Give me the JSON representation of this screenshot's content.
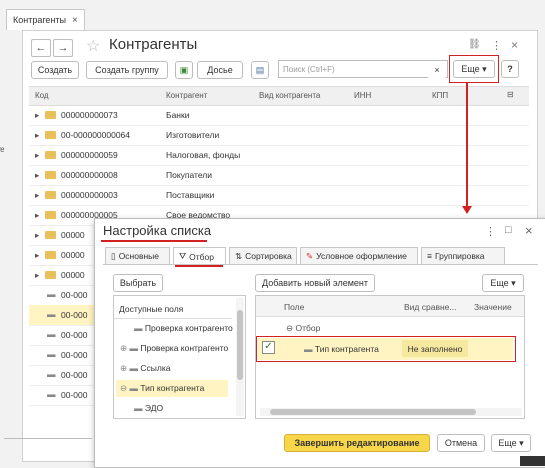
{
  "tab": {
    "label": "Контрагенты",
    "close": "×"
  },
  "window": {
    "title": "Контрагенты",
    "back": "←",
    "forward": "→",
    "star": "☆",
    "link": "🔗",
    "more": "⋮",
    "close": "×",
    "toolbar": {
      "create": "Создать",
      "create_group": "Создать группу",
      "dossier": "Досье",
      "search_placeholder": "Поиск (Ctrl+F)",
      "search_clear": "×",
      "more": "Еще ▾",
      "help": "?"
    },
    "columns": [
      "Код",
      "Контрагент",
      "Вид контрагента",
      "ИНН",
      "КПП"
    ],
    "rows": [
      {
        "code": "000000000073",
        "name": "Банки"
      },
      {
        "code": "00-000000000064",
        "name": "Изготовители"
      },
      {
        "code": "000000000059",
        "name": "Налоговая, фонды"
      },
      {
        "code": "000000000008",
        "name": "Покупатели"
      },
      {
        "code": "000000000003",
        "name": "Поставщики"
      },
      {
        "code": "000000000005",
        "name": "Свое ведомство"
      },
      {
        "code": "00000",
        "name": ""
      },
      {
        "code": "00000",
        "name": ""
      },
      {
        "code": "00000",
        "name": ""
      },
      {
        "code": "00-000",
        "name": ""
      },
      {
        "code": "00-000",
        "name": ""
      },
      {
        "code": "00-000",
        "name": ""
      },
      {
        "code": "00-000",
        "name": ""
      },
      {
        "code": "00-000",
        "name": ""
      },
      {
        "code": "00-000",
        "name": ""
      }
    ]
  },
  "dialog": {
    "title": "Настройка списка",
    "more": "⋮",
    "restore": "□",
    "close": "×",
    "tabs": [
      "Основные",
      "Отбор",
      "Сортировка",
      "Условное оформление",
      "Группировка"
    ],
    "choose": "Выбрать",
    "add_new": "Добавить новый элемент",
    "more_btn": "Еще ▾",
    "available_fields": "Доступные поля",
    "fields": [
      "Проверка контрагенто",
      "Проверка контрагенто",
      "Ссылка",
      "Тип контрагента",
      "ЭДО"
    ],
    "col_field": "Поле",
    "col_compare": "Вид сравне...",
    "col_value": "Значение",
    "filter_group": "Отбор",
    "filter_item": "Тип контрагента",
    "filter_value": "Не заполнено",
    "finish": "Завершить редактирование",
    "cancel": "Отмена",
    "more_bottom": "Еще ▾"
  },
  "colors": {
    "accent": "#f7d64a",
    "annotation": "#d32020"
  }
}
